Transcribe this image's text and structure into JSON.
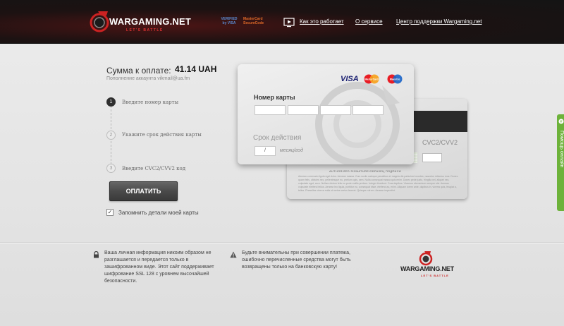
{
  "header": {
    "brand": "WARGAMING.NET",
    "brand_tagline": "LET'S BATTLE",
    "badges": {
      "vbv": "VERIFIED by VISA",
      "msc": "MasterCard SecureCode"
    },
    "nav": [
      {
        "label": "Как это работает"
      },
      {
        "label": "О сервисе"
      },
      {
        "label": "Центр поддержки Wargaming.net"
      }
    ]
  },
  "payment": {
    "sum_label": "Сумма к оплате:",
    "sum_value": "41.14 UAH",
    "account": "Пополнение аккаунта vikmail@ua.fm",
    "steps": [
      {
        "num": "1",
        "label": "Введите номер карты"
      },
      {
        "num": "2",
        "label": "Укажите срок действия карты"
      },
      {
        "num": "3",
        "label": "Введите CVC2/CVV2 код"
      }
    ],
    "pay_button": "ОПЛАТИТЬ",
    "remember_checked": "✓",
    "remember_label": "Запомнить детали моей карты"
  },
  "card_front": {
    "visa": "VISA",
    "mastercard": "MasterCard",
    "maestro": "Maestro",
    "number_label": "Номер карты",
    "number_fields": [
      "",
      "",
      "",
      ""
    ],
    "expiry_label": "Срок действия",
    "expiry_value": "/",
    "expiry_hint": "месяц/год"
  },
  "card_back": {
    "cvc_label": "CVC2/CVV2",
    "auth_text": "AUTHORIZED SIGNATURE/ОБРАЗЕЦ ПОДПИСИ",
    "fine_print": "Aenean commodo ligula eget dolor. Aenean massa. Cum sociis natoque penatibus et magnis dis parturient montes, nascetur ridiculus mus. Donec quam felis, ultricies nec, pellentesque eu, pretium quis, sem. Nulla consequat massa quis enim. Donec pede justo, fringilla vel, aliquet nec, vulputate eget, arcu. Nullam dictum felis eu pede mollis pretium. Integer tincidunt. Cras dapibus. Vivamus elementum semper nisi. Aenean vulputate eleifend tellus. Aenean leo ligula, porttitor eu, consequat vitae, eleifend ac, enim. Aliquam lorem ante, dapibus in, viverra quis, feugiat a, tellus. Phasellus viverra nulla ut metus varius laoreet. Quisque rutrum. Aenean imperdiet."
  },
  "side_tab": {
    "label": "Помощь онлайн"
  },
  "footer": {
    "privacy": "Ваша личная информация никоим образом не разглашается и передается только в зашифрованном виде. Этот сайт поддерживает шифрование SSL 128 с уровнем высочайшей безопасности.",
    "warning": "Будьте внимательны при совершении платежа, ошибочно перечисленные средства могут быть возвращены только на банковскую карту!",
    "brand": "WARGAMING.NET",
    "brand_tagline": "LET'S BATTLE"
  },
  "colors": {
    "header_bg": "#141414",
    "brand_red": "#c22222",
    "side_tab": "#6db23a",
    "pay_button": "#4a4a4a"
  },
  "icons": [
    "wargaming-logo-icon",
    "tv-play-icon",
    "lock-icon",
    "warning-icon",
    "chat-icon"
  ]
}
